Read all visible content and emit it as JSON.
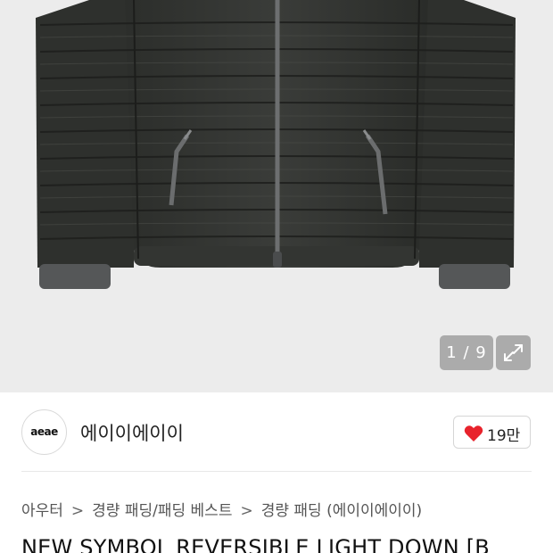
{
  "gallery": {
    "counter": "1 / 9",
    "expand_icon": "expand-icon"
  },
  "brand": {
    "logo_text": "aeae",
    "name": "에이이에이이"
  },
  "like": {
    "count": "19만",
    "heart_color": "#e8232c"
  },
  "breadcrumb": {
    "items": [
      "아우터",
      "경량 패딩/패딩 베스트",
      "경량 패딩 (에이이에이이)"
    ],
    "separator": ">"
  },
  "product": {
    "title": "NEW SYMBOL REVERSIBLE LIGHT DOWN [B"
  }
}
